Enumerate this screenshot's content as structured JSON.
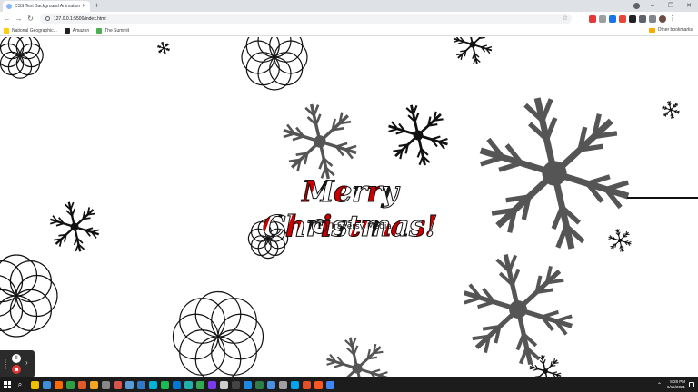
{
  "browser": {
    "tab": {
      "title": "CSS Text Background Animation"
    },
    "address": {
      "url": "127.0.0.1:5500/index.html"
    },
    "bookmarks": [
      {
        "label": "National Geographic...",
        "icon": "natgeo-icon",
        "color": "#ffcc00"
      },
      {
        "label": "Amazon",
        "icon": "amazon-icon",
        "color": "#222222"
      },
      {
        "label": "The Summit",
        "icon": "summit-icon",
        "color": "#4caf50"
      }
    ],
    "other_bookmarks": "Other bookmarks"
  },
  "page": {
    "headline": "Merry Christmas!",
    "brand": {
      "logo_letter": "T",
      "name": "Traversy Media"
    }
  },
  "recorder": {
    "pause_glyph": "II",
    "expand_glyph": "›"
  },
  "taskbar": {
    "time": "8:28 PM",
    "date": "6/15/2021",
    "apps": [
      "#f0c000",
      "#3c8fd8",
      "#ff6a00",
      "#2ea043",
      "#e05a2a",
      "#f5a623",
      "#888888",
      "#d9534f",
      "#5b9bd5",
      "#3178c6",
      "#00b4d8",
      "#1db954",
      "#0078d4",
      "#20b2aa",
      "#34a853",
      "#7c3aed",
      "#cccccc",
      "#444444",
      "#1e88e5",
      "#2d7d46",
      "#4a90e2",
      "#a0a0a0",
      "#00a4ef",
      "#e34f26",
      "#ff5722",
      "#4285f4"
    ]
  }
}
